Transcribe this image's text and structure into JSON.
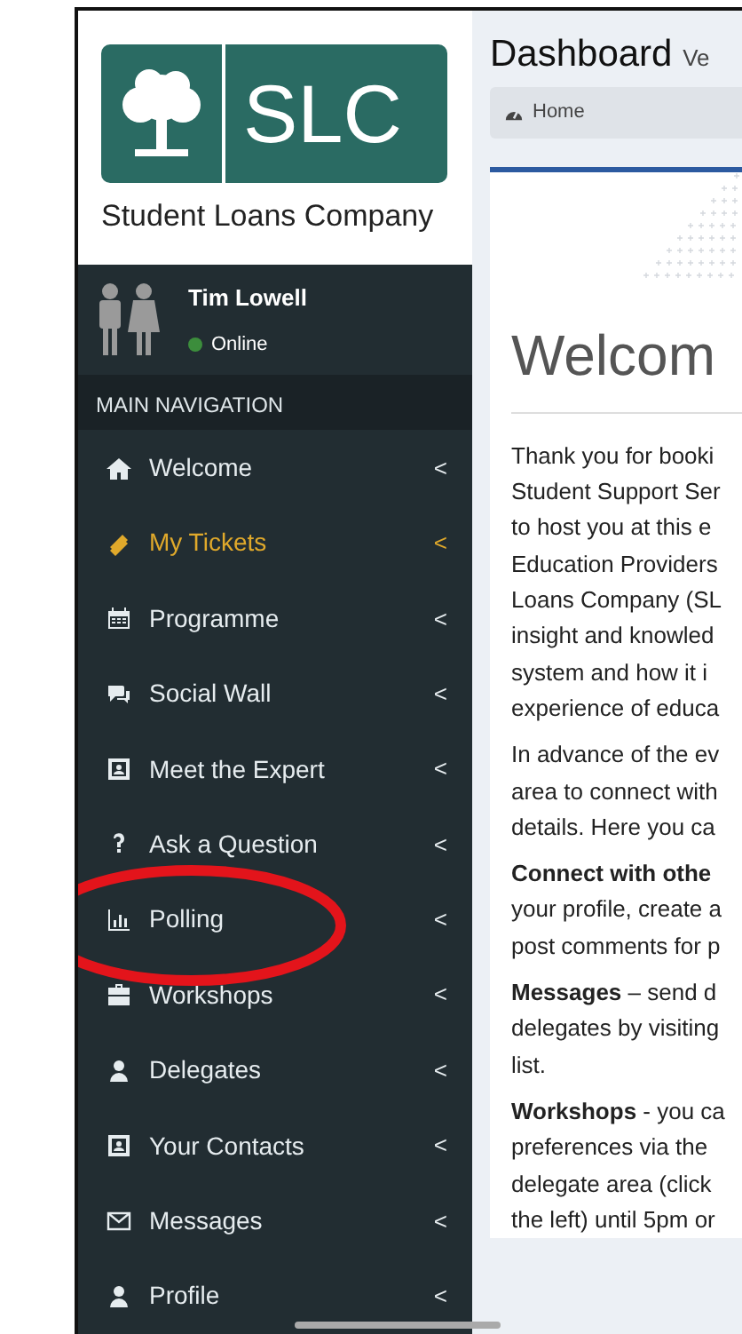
{
  "logo": {
    "mark": "SLC",
    "name": "Student Loans Company"
  },
  "user": {
    "name": "Tim Lowell",
    "status": {
      "label": "Online",
      "color": "#3c8d3c"
    }
  },
  "nav_header": "MAIN NAVIGATION",
  "nav_items": [
    {
      "label": "Welcome",
      "selected": false,
      "arrow": "<"
    },
    {
      "label": "My Tickets",
      "selected": true,
      "arrow": "<"
    },
    {
      "label": "Programme",
      "selected": false,
      "arrow": "<"
    },
    {
      "label": "Social Wall",
      "selected": false,
      "arrow": "<"
    },
    {
      "label": "Meet the Expert",
      "selected": false,
      "arrow": "<"
    },
    {
      "label": "Ask a Question",
      "selected": false,
      "arrow": "<"
    },
    {
      "label": "Polling",
      "selected": false,
      "arrow": "<"
    },
    {
      "label": "Workshops",
      "selected": false,
      "arrow": "<"
    },
    {
      "label": "Delegates",
      "selected": false,
      "arrow": "<"
    },
    {
      "label": "Your Contacts",
      "selected": false,
      "arrow": "<"
    },
    {
      "label": "Messages",
      "selected": false,
      "arrow": "<"
    },
    {
      "label": "Profile",
      "selected": false,
      "arrow": "<"
    }
  ],
  "page_title": "Dashboard",
  "page_subtitle": "Ve",
  "breadcrumb": "Home",
  "welcome_heading": "Welcom",
  "paragraphs": [
    [
      "Thank you for booki",
      "Student Support Ser",
      "to host you at this e",
      "Education Providers",
      "Loans Company (SL",
      "insight and knowled",
      "system and how it i",
      "experience of educa"
    ],
    [
      "In advance of the ev",
      "area to connect with",
      "details. Here you ca"
    ],
    [
      "**Connect with othe**",
      "your profile, create a",
      "post comments for p"
    ],
    [
      "**Messages** – send d",
      "delegates by visiting",
      "list."
    ],
    [
      "**Workshops** - you ca",
      "preferences via the",
      "delegate area (click",
      "the left) until 5pm or"
    ]
  ]
}
